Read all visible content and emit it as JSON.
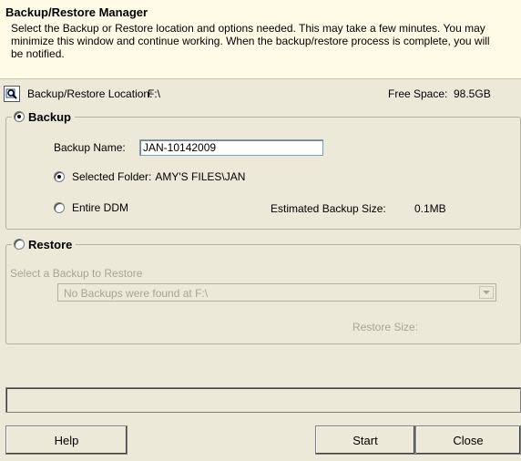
{
  "header": {
    "title": "Backup/Restore Manager",
    "description": "Select the Backup or Restore location and options needed. This may take a few minutes. You may minimize this window and continue working. When the backup/restore process is complete, you will be notified."
  },
  "location": {
    "label": "Backup/Restore Location:",
    "value": "F:\\",
    "free_space_label": "Free Space:",
    "free_space_value": "98.5GB"
  },
  "backup": {
    "legend": "Backup",
    "selected": true,
    "name_label": "Backup Name:",
    "name_value": "JAN-10142009",
    "options": [
      {
        "label": "Selected Folder:",
        "value": "AMY'S FILES\\JAN",
        "checked": true
      },
      {
        "label": "Entire DDM",
        "checked": false
      }
    ],
    "estimated_label": "Estimated Backup Size:",
    "estimated_value": "0.1MB"
  },
  "restore": {
    "legend": "Restore",
    "selected": false,
    "select_label": "Select a Backup to Restore",
    "dropdown_value": "No Backups were found at F:\\",
    "size_label": "Restore Size:"
  },
  "buttons": {
    "help": "Help",
    "start": "Start",
    "close": "Close"
  }
}
